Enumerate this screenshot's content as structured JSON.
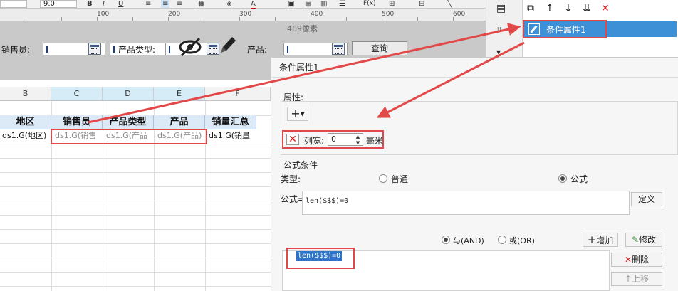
{
  "toolbar": {
    "font_size": "9.0",
    "bold": "B",
    "italic": "I",
    "fx_label": "F(x)"
  },
  "ruler": {
    "labels": [
      "100",
      "200",
      "300",
      "400",
      "500",
      "600"
    ]
  },
  "params": {
    "salesperson_label": "销售员:",
    "product_type_label": "产品类型:",
    "product_label": "产品:",
    "query_button": "查询",
    "dimension_label": "469像素"
  },
  "sheet": {
    "columns": [
      "B",
      "C",
      "D",
      "E",
      "F"
    ],
    "headers": [
      "地区",
      "销售员",
      "产品类型",
      "产品",
      "销量汇总"
    ],
    "cells": [
      "ds1.G(地区)",
      "ds1.G(销售",
      "ds1.G(产品",
      "ds1.G(产品)",
      "ds1.G(销量"
    ]
  },
  "cond_list": {
    "items": [
      "条件属性1"
    ]
  },
  "dialog": {
    "title": "条件属性1",
    "attr_label": "属性:",
    "plus": "+",
    "col_width_label": "列宽:",
    "col_width_value": "0",
    "unit": "毫米",
    "formula_cond_title": "公式条件",
    "type_label": "类型:",
    "type_options": [
      "普通",
      "公式"
    ],
    "type_selected": "公式",
    "formula_label": "公式=",
    "formula_value": "len($$$)=0",
    "define_button": "定义",
    "and_label": "与(AND)",
    "or_label": "或(OR)",
    "logic_selected": "与(AND)",
    "add_button": "增加",
    "modify_button": "修改",
    "delete_button": "删除",
    "up_button": "上移",
    "result_item": "len($$$)=0"
  },
  "colors": {
    "accent": "#3d8fd6",
    "annotation_red": "#e34848",
    "header_fill": "#dce9f6"
  }
}
